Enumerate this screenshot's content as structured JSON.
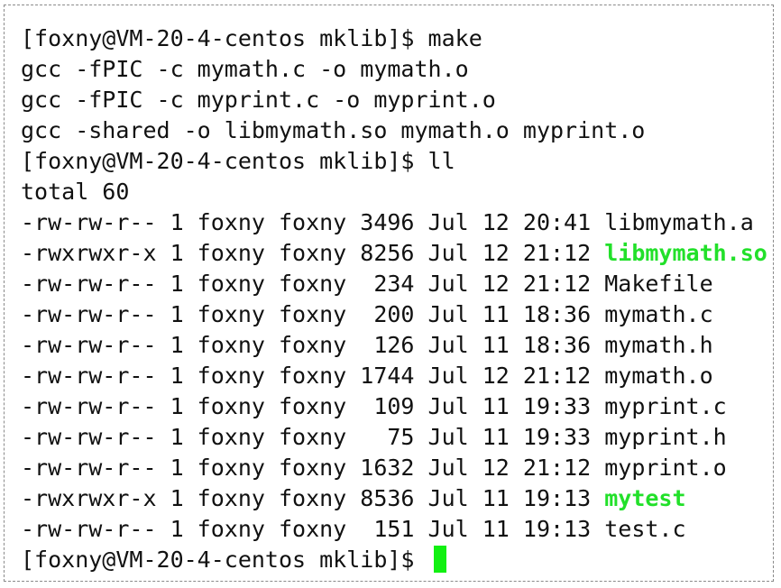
{
  "terminal": {
    "prompt": "[foxny@VM-20-4-centos mklib]$",
    "colors": {
      "text": "#111111",
      "executable": "#22e02a",
      "cursor": "#12f012",
      "border": "#8a8a8a"
    },
    "lines": [
      {
        "text": "[foxny@VM-20-4-centos mklib]$ make"
      },
      {
        "text": "gcc -fPIC -c mymath.c -o mymath.o"
      },
      {
        "text": "gcc -fPIC -c myprint.c -o myprint.o"
      },
      {
        "text": "gcc -shared -o libmymath.so mymath.o myprint.o"
      },
      {
        "text": "[foxny@VM-20-4-centos mklib]$ ll"
      },
      {
        "text": "total 60"
      }
    ],
    "listing": [
      {
        "meta": "-rw-rw-r-- 1 foxny foxny 3496 Jul 12 20:41 ",
        "name": "libmymath.a",
        "exec": false
      },
      {
        "meta": "-rwxrwxr-x 1 foxny foxny 8256 Jul 12 21:12 ",
        "name": "libmymath.so",
        "exec": true
      },
      {
        "meta": "-rw-rw-r-- 1 foxny foxny  234 Jul 12 21:12 ",
        "name": "Makefile",
        "exec": false
      },
      {
        "meta": "-rw-rw-r-- 1 foxny foxny  200 Jul 11 18:36 ",
        "name": "mymath.c",
        "exec": false
      },
      {
        "meta": "-rw-rw-r-- 1 foxny foxny  126 Jul 11 18:36 ",
        "name": "mymath.h",
        "exec": false
      },
      {
        "meta": "-rw-rw-r-- 1 foxny foxny 1744 Jul 12 21:12 ",
        "name": "mymath.o",
        "exec": false
      },
      {
        "meta": "-rw-rw-r-- 1 foxny foxny  109 Jul 11 19:33 ",
        "name": "myprint.c",
        "exec": false
      },
      {
        "meta": "-rw-rw-r-- 1 foxny foxny   75 Jul 11 19:33 ",
        "name": "myprint.h",
        "exec": false
      },
      {
        "meta": "-rw-rw-r-- 1 foxny foxny 1632 Jul 12 21:12 ",
        "name": "myprint.o",
        "exec": false
      },
      {
        "meta": "-rwxrwxr-x 1 foxny foxny 8536 Jul 11 19:13 ",
        "name": "mytest",
        "exec": true
      },
      {
        "meta": "-rw-rw-r-- 1 foxny foxny  151 Jul 11 19:13 ",
        "name": "test.c",
        "exec": false
      }
    ],
    "final_prompt": "[foxny@VM-20-4-centos mklib]$ "
  }
}
